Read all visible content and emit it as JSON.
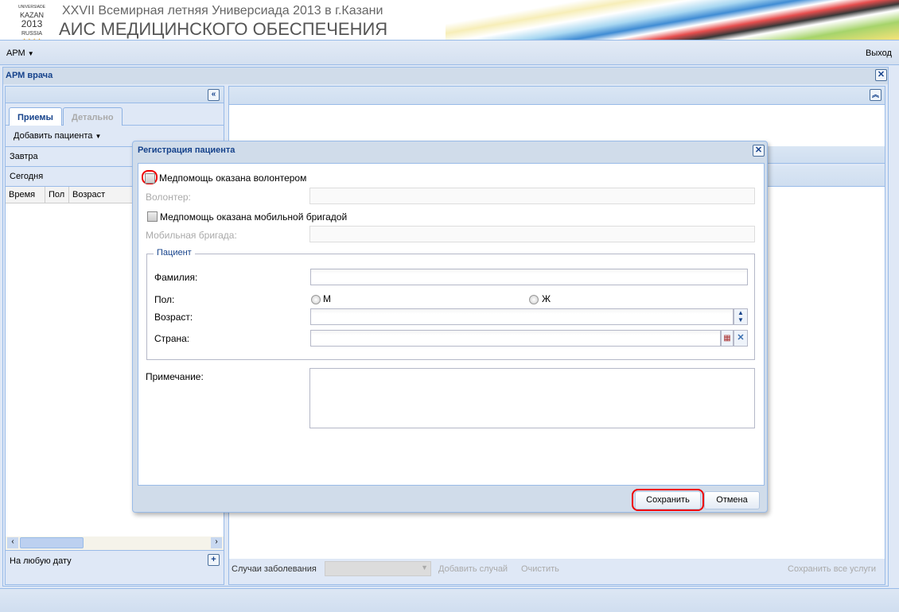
{
  "header": {
    "logo_text": [
      "UNIVERSIADE",
      "KAZAN",
      "2013",
      "RUSSIA"
    ],
    "subtitle": "XXVII Всемирная летняя Универсиада 2013 в г.Казани",
    "title": "АИС МЕДИЦИНСКОГО ОБЕСПЕЧЕНИЯ"
  },
  "menu": {
    "arm": "АРМ",
    "exit": "Выход"
  },
  "workspace": {
    "title": "АРМ врача"
  },
  "left": {
    "tabs": [
      "Приемы",
      "Детально"
    ],
    "add_patient": "Добавить пациента",
    "groups": [
      "Завтра",
      "Сегодня"
    ],
    "columns": [
      "Время",
      "Пол",
      "Возраст"
    ],
    "footer": "На любую дату"
  },
  "right": {
    "cases_label": "Случаи заболевания",
    "add_case": "Добавить случай",
    "clear": "Очистить",
    "save_all": "Сохранить все услуги"
  },
  "dialog": {
    "title": "Регистрация пациента",
    "volunteer_check": "Медпомощь оказана волонтером",
    "volunteer_label": "Волонтер:",
    "mobile_check": "Медпомощь оказана мобильной бригадой",
    "mobile_label": "Мобильная бригада:",
    "fieldset": "Пациент",
    "surname": "Фамилия:",
    "sex": "Пол:",
    "sex_m": "М",
    "sex_f": "Ж",
    "age": "Возраст:",
    "country": "Страна:",
    "note": "Примечание:",
    "save": "Сохранить",
    "cancel": "Отмена"
  }
}
